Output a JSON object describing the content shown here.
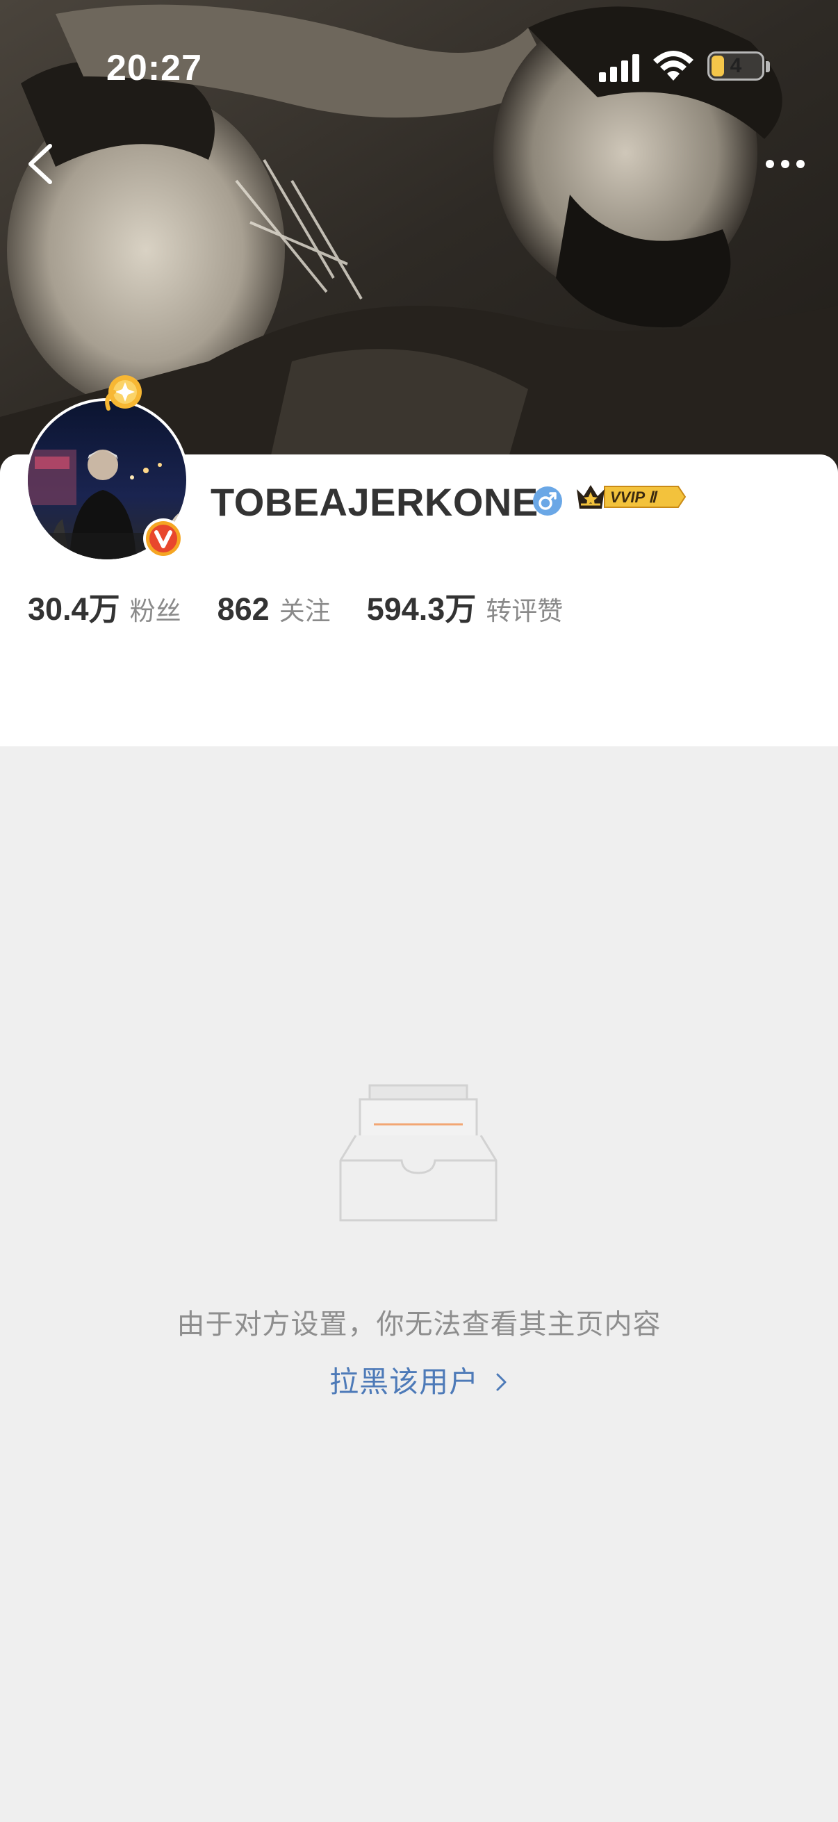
{
  "status_bar": {
    "time": "20:27",
    "battery_level": "4",
    "icons": [
      "cellular-signal-icon",
      "wifi-icon",
      "battery-icon"
    ]
  },
  "nav": {
    "back_icon": "chevron-left-icon",
    "more_icon": "more-horizontal-icon"
  },
  "profile": {
    "username": "TOBEAJERKONE",
    "gender_icon": "male-icon",
    "vip_badge": "VVIP Ⅱ",
    "verified_icon": "verified-v-icon",
    "stats": [
      {
        "value": "30.4万",
        "label": "粉丝"
      },
      {
        "value": "862",
        "label": "关注"
      },
      {
        "value": "594.3万",
        "label": "转评赞"
      }
    ]
  },
  "empty_state": {
    "icon": "empty-box-icon",
    "message": "由于对方设置，你无法查看其主页内容",
    "action_label": "拉黑该用户",
    "action_icon": "chevron-right-icon"
  },
  "colors": {
    "background": "#efefef",
    "card": "#ffffff",
    "link": "#4d7ab8",
    "text_primary": "#333333",
    "text_secondary": "#8a8a8a",
    "gender_blue": "#6aa7e6",
    "verified_orange": "#f5a623"
  }
}
